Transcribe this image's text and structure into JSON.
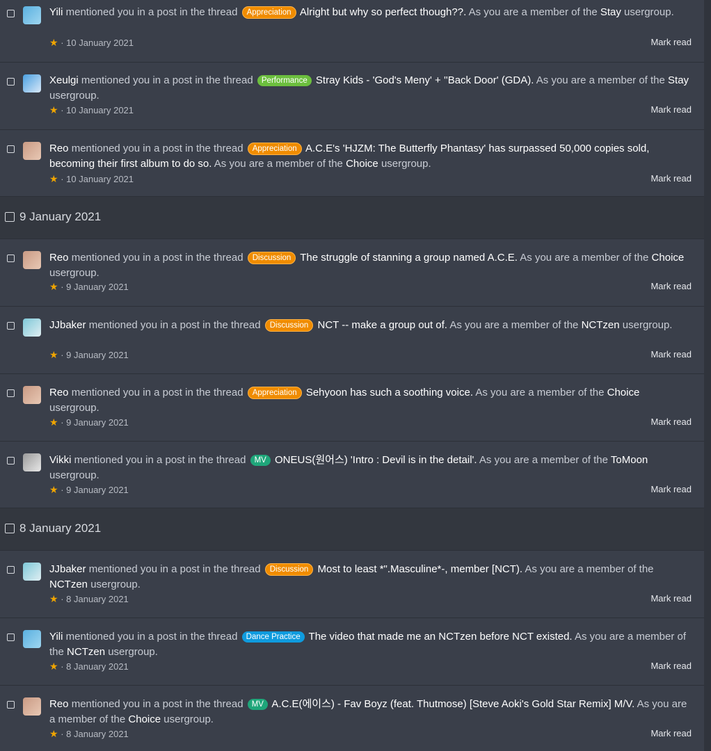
{
  "text": {
    "mentioned": "mentioned you in a post in the thread",
    "as_member_pre": "As you are a member of the",
    "usergroup": "usergroup.",
    "mark_read": "Mark read",
    "dot": "·"
  },
  "items": [
    {
      "user": "Yili",
      "prefix": "Appreciation",
      "prefix_style": "orange",
      "title": "Alright but why so perfect though??.",
      "group": "Stay",
      "date": "10 January 2021"
    },
    {
      "user": "Xeulgi",
      "prefix": "Performance",
      "prefix_style": "green",
      "title": "Stray Kids - 'God's Meny' + ''Back Door' (GDA).",
      "group": "Stay",
      "date": "10 January 2021"
    },
    {
      "user": "Reo",
      "prefix": "Appreciation",
      "prefix_style": "orange",
      "title": "A.C.E's 'HJZM: The Butterfly Phantasy' has surpassed 50,000 copies sold, becoming their first album to do so.",
      "group": "Choice",
      "date": "10 January 2021"
    },
    {
      "user": "Reo",
      "prefix": "Discussion",
      "prefix_style": "orange",
      "title": "The struggle of stanning a group named A.C.E.",
      "group": "Choice",
      "date": "9 January 2021"
    },
    {
      "user": "JJbaker",
      "prefix": "Discussion",
      "prefix_style": "orange",
      "title": "NCT -- make a group out of.",
      "group": "NCTzen",
      "date": "9 January 2021"
    },
    {
      "user": "Reo",
      "prefix": "Appreciation",
      "prefix_style": "orange",
      "title": "Sehyoon has such a soothing voice.",
      "group": "Choice",
      "date": "9 January 2021"
    },
    {
      "user": "Vikki",
      "prefix": "MV",
      "prefix_style": "mv",
      "title": "ONEUS(원어스) 'Intro : Devil is in the detail'.",
      "group": "ToMoon",
      "date": "9 January 2021"
    },
    {
      "user": "JJbaker",
      "prefix": "Discussion",
      "prefix_style": "orange",
      "title": "Most to least *\".Masculine*-, member [NCT).",
      "group": "NCTzen",
      "date": "8 January 2021"
    },
    {
      "user": "Yili",
      "prefix": "Dance Practice",
      "prefix_style": "blue",
      "title": "The video that made me an NCTzen before NCT existed.",
      "group": "NCTzen",
      "date": "8 January 2021"
    },
    {
      "user": "Reo",
      "prefix": "MV",
      "prefix_style": "mv",
      "title": "A.C.E(에이스) - Fav Boyz (feat. Thutmose) [Steve Aoki's Gold Star Remix] M/V.",
      "group": "Choice",
      "date": "8 January 2021"
    }
  ],
  "groups": [
    {
      "label": "9 January 2021"
    },
    {
      "label": "8 January 2021"
    }
  ],
  "colors": {
    "background": "#3a3f4a",
    "group_header": "#33373f",
    "prefix_orange": "#f08c00",
    "prefix_green": "#6cbf3e",
    "prefix_mv": "#1fa67a",
    "prefix_blue": "#0f9bde",
    "star": "#f0a500"
  },
  "icons": {
    "star": "star-icon",
    "avatar": "user-avatar"
  }
}
